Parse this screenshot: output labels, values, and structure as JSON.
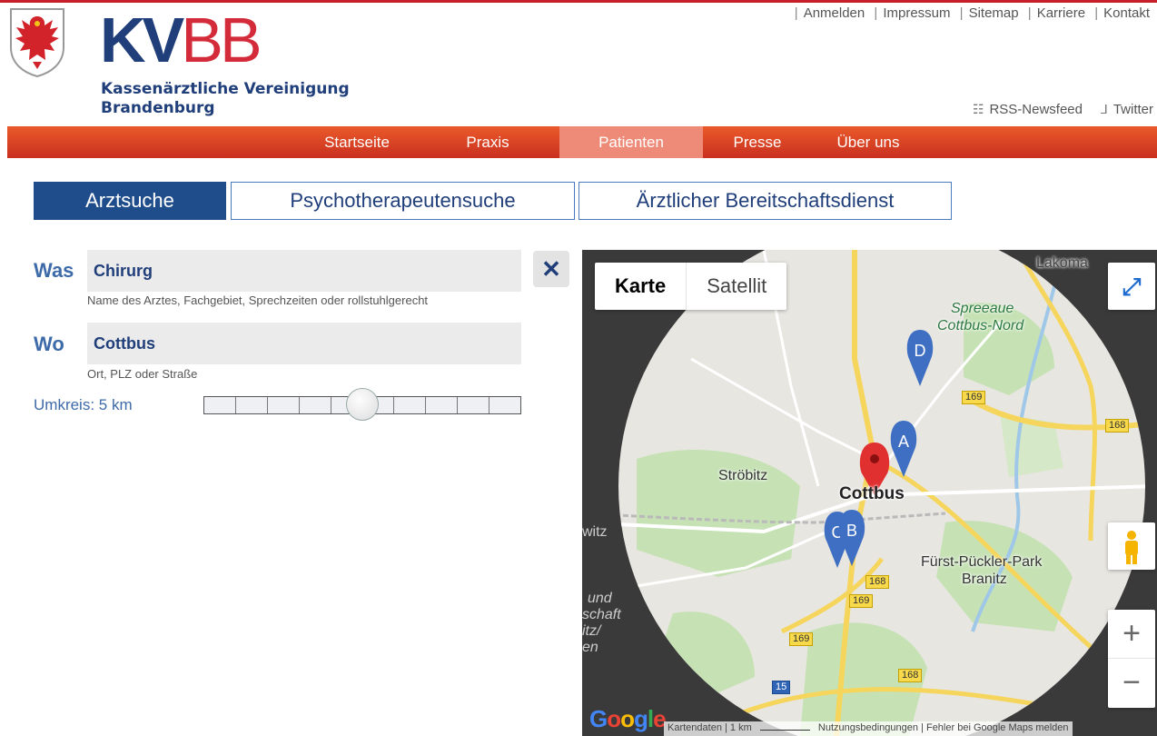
{
  "header": {
    "logo_kv": "KV",
    "logo_bb": "BB",
    "logo_subtitle_line1": "Kassenärztliche Vereinigung",
    "logo_subtitle_line2": "Brandenburg",
    "top_links": [
      "Anmelden",
      "Impressum",
      "Sitemap",
      "Karriere",
      "Kontakt"
    ],
    "rss_label": "RSS-Newsfeed",
    "twitter_label": "Twitter"
  },
  "nav": {
    "items": [
      "Startseite",
      "Praxis",
      "Patienten",
      "Presse",
      "Über uns"
    ],
    "active": "Patienten"
  },
  "tabs": {
    "items": [
      "Arztsuche",
      "Psychotherapeutensuche",
      "Ärztlicher Bereitschaftsdienst"
    ],
    "active": "Arztsuche"
  },
  "search": {
    "was_label": "Was",
    "was_value": "Chirurg",
    "was_hint": "Name des Arztes, Fachgebiet, Sprechzeiten oder rollstuhlgerecht",
    "wo_label": "Wo",
    "wo_value": "Cottbus",
    "wo_hint": "Ort, PLZ oder Straße",
    "clear_symbol": "✕",
    "radius_label": "Umkreis: 5 km",
    "radius_level": 0.5
  },
  "map": {
    "type_options": [
      "Karte",
      "Satellit"
    ],
    "active_type": "Karte",
    "labels": {
      "lakoma": "Lakoma",
      "spreeaue": "Spreeaue",
      "cottbus_nord": "Cottbus-Nord",
      "stroebitz": "Ströbitz",
      "cottbus": "Cottbus",
      "fuerst": "Fürst-Pückler-Park",
      "branitz": "Branitz",
      "witz": "witz",
      "und": "und",
      "schaft": "schaft",
      "itz": "itz/",
      "en": "en"
    },
    "markers": [
      "A",
      "B",
      "C",
      "D"
    ],
    "road_numbers": {
      "r169": "169",
      "r168": "168",
      "r15": "15"
    },
    "footer": {
      "kartendaten": "Kartendaten",
      "scale": "1 km",
      "terms": "Nutzungsbedingungen",
      "report": "Fehler bei Google Maps melden"
    },
    "google_logo": "Google",
    "zoom_in": "+",
    "zoom_out": "−"
  },
  "colors": {
    "brand_blue": "#1f3e7a",
    "brand_red": "#d42b3a",
    "nav_orange": "#e04a27",
    "marker_blue": "#3f6fc2",
    "marker_red": "#e03030"
  }
}
